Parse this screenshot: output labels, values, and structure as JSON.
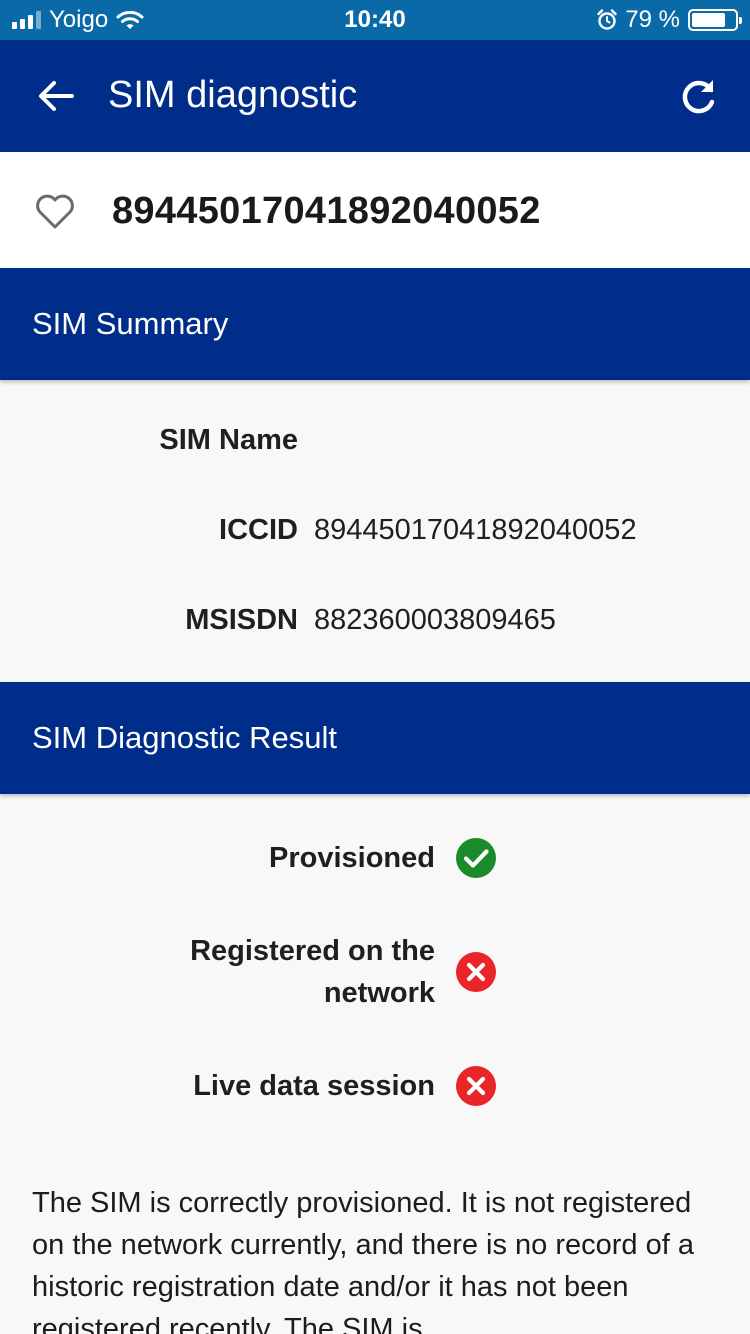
{
  "status_bar": {
    "carrier": "Yoigo",
    "time": "10:40",
    "battery_text": "79 %",
    "battery_level": 0.79
  },
  "app_bar": {
    "title": "SIM diagnostic",
    "back_icon": "arrow-left-icon",
    "refresh_icon": "refresh-icon"
  },
  "sim_header": {
    "iccid": "89445017041892040052",
    "favorite_icon": "heart-outline-icon"
  },
  "summary": {
    "heading": "SIM Summary",
    "rows": [
      {
        "label": "SIM Name",
        "value": ""
      },
      {
        "label": "ICCID",
        "value": "89445017041892040052"
      },
      {
        "label": "MSISDN",
        "value": "882360003809465"
      }
    ]
  },
  "diagnostic": {
    "heading": "SIM Diagnostic Result",
    "checks": [
      {
        "label": "Provisioned",
        "status": "ok",
        "icon": "check-circle-icon"
      },
      {
        "label": "Registered on the network",
        "status": "fail",
        "icon": "x-circle-icon"
      },
      {
        "label": "Live data session",
        "status": "fail",
        "icon": "x-circle-icon"
      }
    ],
    "description": "The SIM is correctly provisioned. It is not registered on the network currently, and there is no record of a historic registration date and/or it has not been registered recently. The SIM is"
  },
  "colors": {
    "status_bar": "#0a6aa8",
    "primary": "#002c8a",
    "success": "#1a8a2a",
    "error": "#e8262a",
    "background": "#f8f8f8"
  }
}
